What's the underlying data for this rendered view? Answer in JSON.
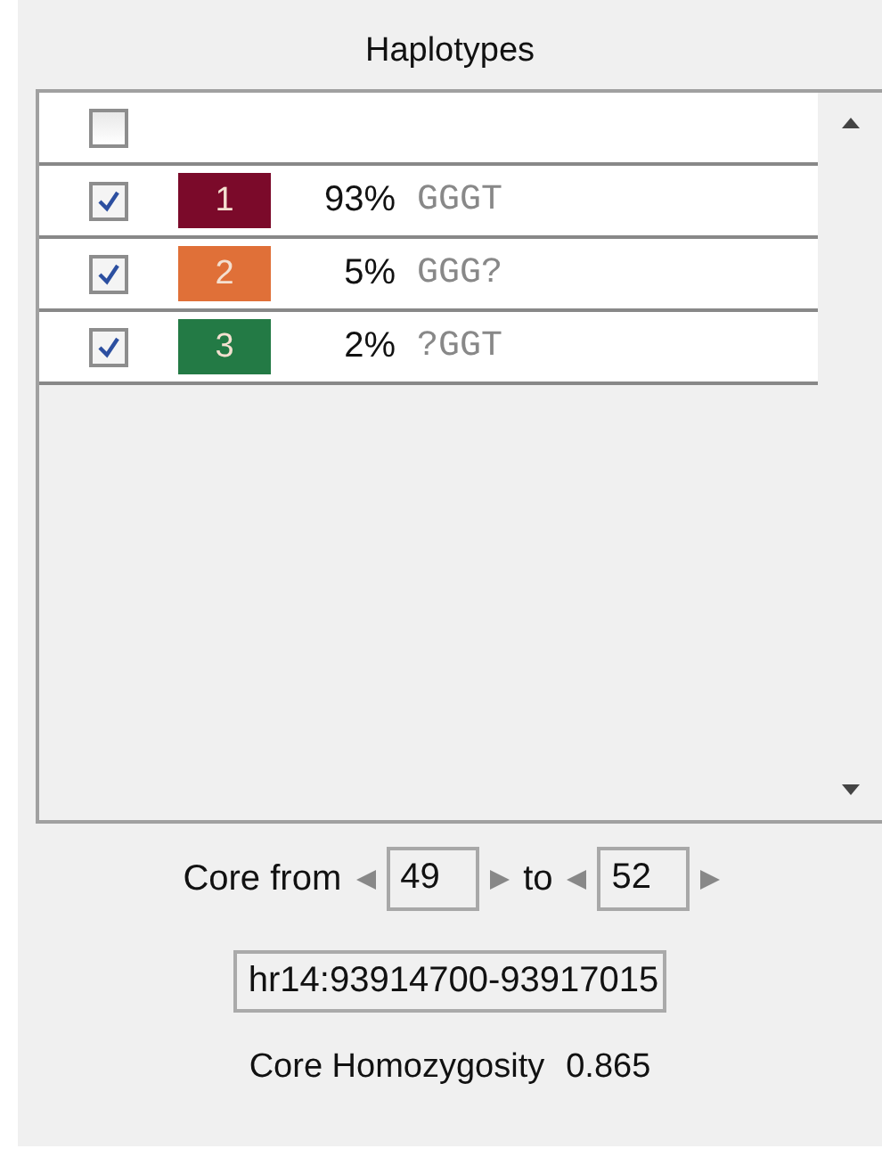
{
  "title": "Haplotypes",
  "select_all": {
    "checked": false
  },
  "haplotypes": [
    {
      "checked": true,
      "number": "1",
      "color": "#7b0a2a",
      "percent": "93%",
      "sequence": "GGGT"
    },
    {
      "checked": true,
      "number": "2",
      "color": "#e07038",
      "percent": "5%",
      "sequence": "GGG?"
    },
    {
      "checked": true,
      "number": "3",
      "color": "#237a45",
      "percent": "2%",
      "sequence": "?GGT"
    }
  ],
  "core": {
    "from_label": "Core from",
    "from_value": "49",
    "to_label": "to",
    "to_value": "52"
  },
  "region": {
    "value": "hr14:93914700-93917015"
  },
  "homozygosity": {
    "label": "Core Homozygosity",
    "value": "0.865"
  }
}
